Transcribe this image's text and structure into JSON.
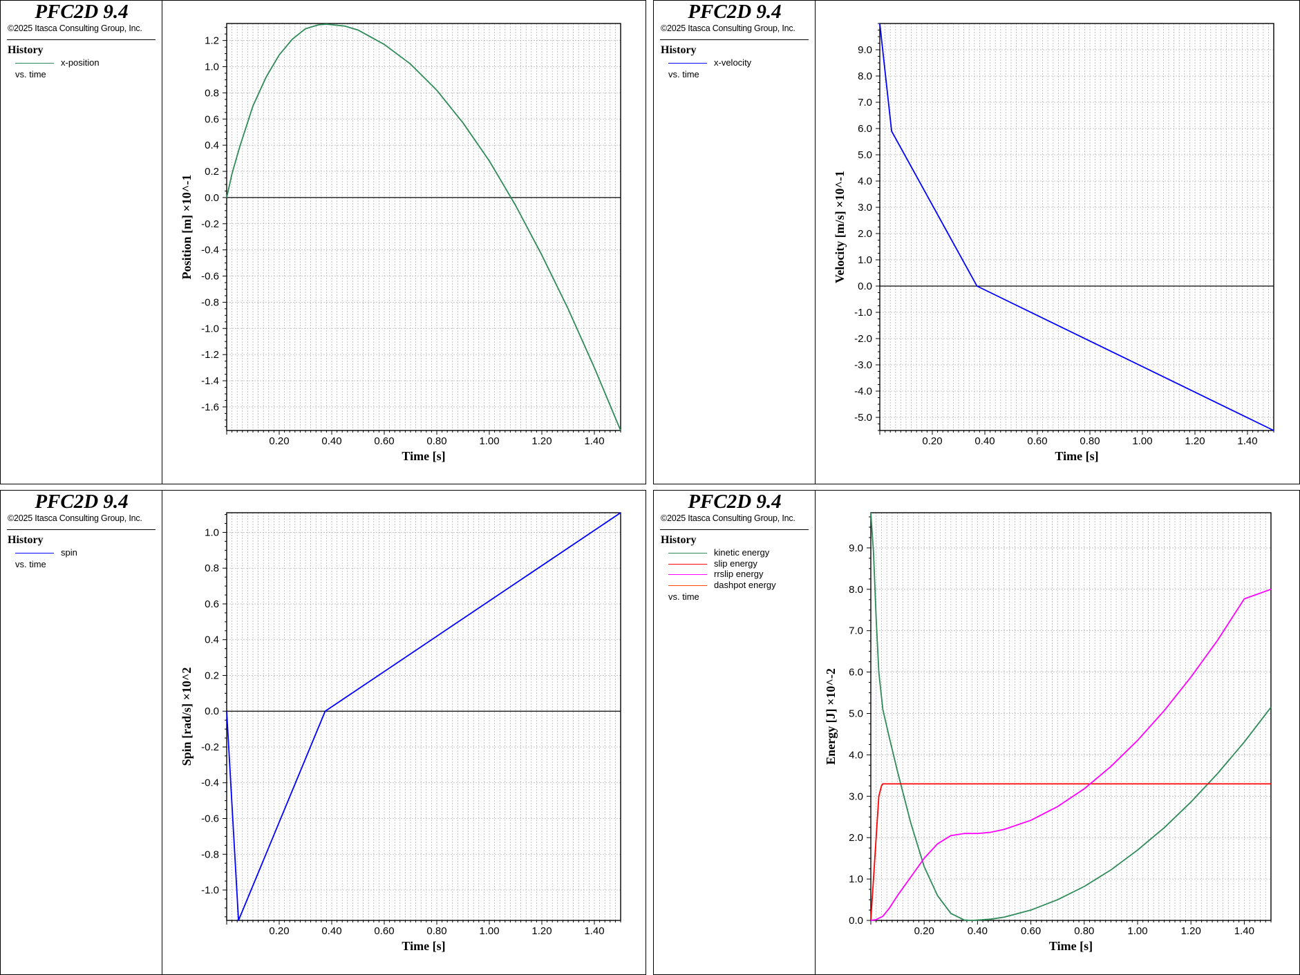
{
  "panels": [
    {
      "app_title": "PFC2D 9.4",
      "copyright": "©2025 Itasca Consulting Group, Inc.",
      "legend_heading": "History",
      "legend_items": [
        {
          "label": "x-position",
          "color": "#2e8b57"
        }
      ],
      "legend_vs": "vs. time"
    },
    {
      "app_title": "PFC2D 9.4",
      "copyright": "©2025 Itasca Consulting Group, Inc.",
      "legend_heading": "History",
      "legend_items": [
        {
          "label": "x-velocity",
          "color": "#0000ff"
        }
      ],
      "legend_vs": "vs. time"
    },
    {
      "app_title": "PFC2D 9.4",
      "copyright": "©2025 Itasca Consulting Group, Inc.",
      "legend_heading": "History",
      "legend_items": [
        {
          "label": "spin",
          "color": "#0000ff"
        }
      ],
      "legend_vs": "vs. time"
    },
    {
      "app_title": "PFC2D 9.4",
      "copyright": "©2025 Itasca Consulting Group, Inc.",
      "legend_heading": "History",
      "legend_items": [
        {
          "label": "kinetic energy",
          "color": "#2e8b57"
        },
        {
          "label": "slip energy",
          "color": "#ff0000"
        },
        {
          "label": "rrslip energy",
          "color": "#ff00ff"
        },
        {
          "label": "dashpot energy",
          "color": "#ff4500"
        }
      ],
      "legend_vs": "vs. time"
    }
  ],
  "chart_data": [
    {
      "type": "line",
      "xlabel": "Time [s]",
      "ylabel": "Position [m] ×10^-1",
      "xlim": [
        0,
        1.5
      ],
      "ylim": [
        -1.78,
        1.33
      ],
      "xticks": [
        "0.20",
        "0.40",
        "0.60",
        "0.80",
        "1.00",
        "1.20",
        "1.40"
      ],
      "yticks": [
        "1.2",
        "1.0",
        "0.8",
        "0.6",
        "0.4",
        "0.2",
        "0.0",
        "-0.2",
        "-0.4",
        "-0.6",
        "-0.8",
        "-1.0",
        "-1.2",
        "-1.4",
        "-1.6"
      ],
      "grid": true,
      "series": [
        {
          "name": "x-position",
          "color": "#2e8b57",
          "x": [
            0,
            0.02,
            0.05,
            0.1,
            0.15,
            0.2,
            0.25,
            0.3,
            0.35,
            0.38,
            0.45,
            0.5,
            0.6,
            0.7,
            0.8,
            0.9,
            1.0,
            1.1,
            1.2,
            1.3,
            1.4,
            1.5
          ],
          "y": [
            0,
            0.18,
            0.39,
            0.7,
            0.92,
            1.09,
            1.21,
            1.29,
            1.32,
            1.325,
            1.31,
            1.28,
            1.17,
            1.02,
            0.82,
            0.57,
            0.28,
            -0.06,
            -0.44,
            -0.85,
            -1.3,
            -1.78
          ]
        }
      ]
    },
    {
      "type": "line",
      "xlabel": "Time [s]",
      "ylabel": "Velocity [m/s] ×10^-1",
      "xlim": [
        0,
        1.5
      ],
      "ylim": [
        -5.5,
        10.0
      ],
      "xticks": [
        "0.20",
        "0.40",
        "0.60",
        "0.80",
        "1.00",
        "1.20",
        "1.40"
      ],
      "yticks": [
        "9.0",
        "8.0",
        "7.0",
        "6.0",
        "5.0",
        "4.0",
        "3.0",
        "2.0",
        "1.0",
        "0.0",
        "-1.0",
        "-2.0",
        "-3.0",
        "-4.0",
        "-5.0"
      ],
      "grid": true,
      "series": [
        {
          "name": "x-velocity",
          "color": "#0000ff",
          "x": [
            0,
            0.045,
            0.37,
            1.5
          ],
          "y": [
            10.0,
            5.9,
            0.0,
            -5.5
          ]
        }
      ]
    },
    {
      "type": "line",
      "xlabel": "Time [s]",
      "ylabel": "Spin [rad/s] ×10^2",
      "xlim": [
        0,
        1.5
      ],
      "ylim": [
        -1.17,
        1.11
      ],
      "xticks": [
        "0.20",
        "0.40",
        "0.60",
        "0.80",
        "1.00",
        "1.20",
        "1.40"
      ],
      "yticks": [
        "1.0",
        "0.8",
        "0.6",
        "0.4",
        "0.2",
        "0.0",
        "-0.2",
        "-0.4",
        "-0.6",
        "-0.8",
        "-1.0"
      ],
      "grid": true,
      "series": [
        {
          "name": "spin",
          "color": "#0000ff",
          "x": [
            0,
            0.045,
            0.375,
            1.5
          ],
          "y": [
            0,
            -1.17,
            0.0,
            1.11
          ]
        }
      ]
    },
    {
      "type": "line",
      "xlabel": "Time [s]",
      "ylabel": "Energy [J] ×10^-2",
      "xlim": [
        0,
        1.5
      ],
      "ylim": [
        0,
        9.85
      ],
      "xticks": [
        "0.20",
        "0.40",
        "0.60",
        "0.80",
        "1.00",
        "1.20",
        "1.40"
      ],
      "yticks": [
        "9.0",
        "8.0",
        "7.0",
        "6.0",
        "5.0",
        "4.0",
        "3.0",
        "2.0",
        "1.0",
        "0.0"
      ],
      "grid": true,
      "series": [
        {
          "name": "kinetic energy",
          "color": "#2e8b57",
          "x": [
            0,
            0.01,
            0.02,
            0.03,
            0.045,
            0.07,
            0.1,
            0.15,
            0.2,
            0.25,
            0.3,
            0.35,
            0.38,
            0.45,
            0.5,
            0.6,
            0.7,
            0.8,
            0.9,
            1.0,
            1.1,
            1.2,
            1.3,
            1.4,
            1.5
          ],
          "y": [
            9.85,
            8.9,
            7.3,
            6.0,
            5.1,
            4.4,
            3.6,
            2.35,
            1.3,
            0.6,
            0.17,
            0.01,
            0.0,
            0.03,
            0.08,
            0.25,
            0.5,
            0.82,
            1.22,
            1.7,
            2.24,
            2.86,
            3.55,
            4.31,
            5.15
          ]
        },
        {
          "name": "slip energy",
          "color": "#ff0000",
          "x": [
            0,
            0.03,
            0.04,
            0.045,
            0.05,
            1.5
          ],
          "y": [
            0,
            3.0,
            3.25,
            3.3,
            3.3,
            3.3
          ]
        },
        {
          "name": "rrslip energy",
          "color": "#ff00ff",
          "x": [
            0,
            0.02,
            0.045,
            0.07,
            0.1,
            0.15,
            0.2,
            0.25,
            0.3,
            0.35,
            0.4,
            0.45,
            0.5,
            0.6,
            0.7,
            0.8,
            0.9,
            1.0,
            1.1,
            1.2,
            1.3,
            1.4,
            1.5
          ],
          "y": [
            0,
            0.02,
            0.1,
            0.3,
            0.6,
            1.05,
            1.5,
            1.85,
            2.05,
            2.1,
            2.1,
            2.13,
            2.2,
            2.42,
            2.75,
            3.18,
            3.72,
            4.35,
            5.07,
            5.88,
            6.77,
            7.77,
            8.0
          ]
        },
        {
          "name": "dashpot energy",
          "color": "#ff4500",
          "x": [],
          "y": []
        }
      ]
    }
  ]
}
